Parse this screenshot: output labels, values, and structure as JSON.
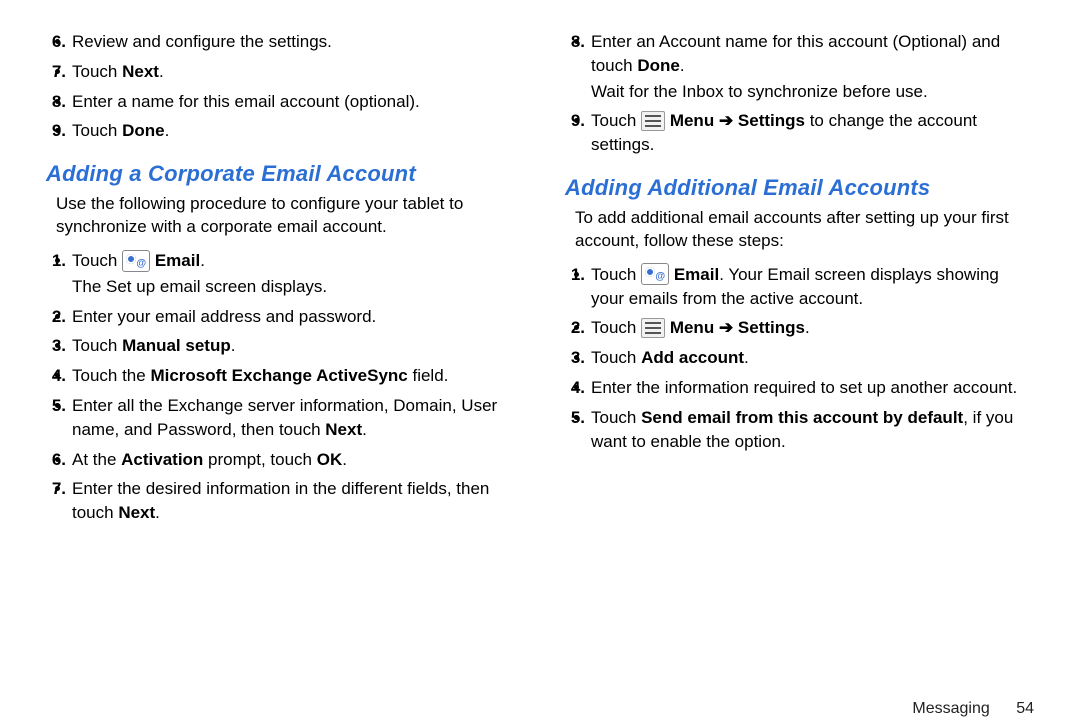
{
  "left": {
    "cont": {
      "s6": {
        "text": "Review and configure the settings."
      },
      "s7": {
        "a": "Touch ",
        "b": "Next",
        "c": "."
      },
      "s8": {
        "text": "Enter a name for this email account (optional)."
      },
      "s9": {
        "a": "Touch ",
        "b": "Done",
        "c": "."
      }
    },
    "heading": "Adding a Corporate Email Account",
    "intro": "Use the following procedure to configure your tablet to synchronize with a corporate email account.",
    "steps": {
      "s1": {
        "a": "Touch ",
        "b": " Email",
        "c": ".",
        "sub": "The Set up email screen displays."
      },
      "s2": {
        "text": "Enter your email address and password."
      },
      "s3": {
        "a": "Touch ",
        "b": "Manual setup",
        "c": "."
      },
      "s4": {
        "a": "Touch the ",
        "b": "Microsoft Exchange ActiveSync",
        "c": " field."
      },
      "s5": {
        "a": "Enter all the Exchange server information, Domain, User name, and Password, then touch ",
        "b": "Next",
        "c": "."
      },
      "s6": {
        "a": "At the ",
        "b": "Activation",
        "c": " prompt, touch ",
        "d": "OK",
        "e": "."
      },
      "s7": {
        "a": "Enter the desired information in the different fields, then touch ",
        "b": "Next",
        "c": "."
      }
    }
  },
  "right": {
    "cont": {
      "s8": {
        "a": "Enter an Account name for this account (Optional) and touch ",
        "b": "Done",
        "c": ".",
        "sub": "Wait for the Inbox to synchronize before use."
      },
      "s9": {
        "a": "Touch ",
        "b": " Menu ",
        "arrow": "➔",
        "c": " Settings",
        "d": " to change the account settings."
      }
    },
    "heading": "Adding Additional Email Accounts",
    "intro": "To add additional email accounts after setting up your first account, follow these steps:",
    "steps": {
      "s1": {
        "a": "Touch ",
        "b": " Email",
        "c": ". Your Email screen displays showing your emails from the active account."
      },
      "s2": {
        "a": "Touch ",
        "b": " Menu ",
        "arrow": "➔",
        "c": " Settings",
        "d": "."
      },
      "s3": {
        "a": "Touch ",
        "b": "Add account",
        "c": "."
      },
      "s4": {
        "text": "Enter the information required to set up another account."
      },
      "s5": {
        "a": "Touch ",
        "b": "Send email from this account by default",
        "c": ", if you want to enable the option."
      }
    }
  },
  "footer": {
    "section": "Messaging",
    "page": "54"
  }
}
